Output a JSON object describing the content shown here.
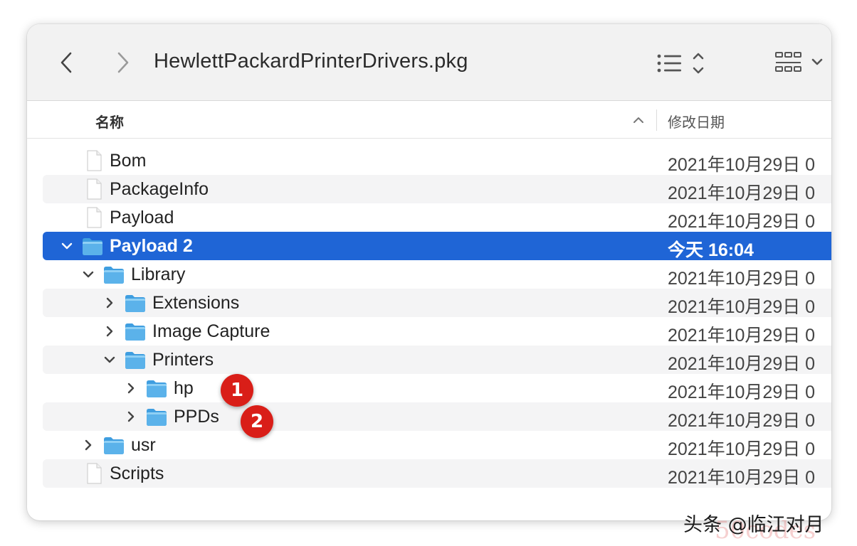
{
  "window": {
    "title": "HewlettPackardPrinterDrivers.pkg"
  },
  "columns": {
    "name": "名称",
    "date": "修改日期"
  },
  "rows": [
    {
      "name": "Bom",
      "date": "2021年10月29日 0",
      "kind": "file",
      "disclosure": "none",
      "selected": false
    },
    {
      "name": "PackageInfo",
      "date": "2021年10月29日 0",
      "kind": "file",
      "disclosure": "none",
      "selected": false
    },
    {
      "name": "Payload",
      "date": "2021年10月29日 0",
      "kind": "file",
      "disclosure": "none",
      "selected": false
    },
    {
      "name": "Payload 2",
      "date": "今天 16:04",
      "kind": "folder",
      "disclosure": "expanded",
      "selected": true
    },
    {
      "name": "Library",
      "date": "2021年10月29日 0",
      "kind": "folder",
      "disclosure": "expanded",
      "selected": false
    },
    {
      "name": "Extensions",
      "date": "2021年10月29日 0",
      "kind": "folder",
      "disclosure": "collapsed",
      "selected": false
    },
    {
      "name": "Image Capture",
      "date": "2021年10月29日 0",
      "kind": "folder",
      "disclosure": "collapsed",
      "selected": false
    },
    {
      "name": "Printers",
      "date": "2021年10月29日 0",
      "kind": "folder",
      "disclosure": "expanded",
      "selected": false
    },
    {
      "name": "hp",
      "date": "2021年10月29日 0",
      "kind": "folder",
      "disclosure": "collapsed",
      "selected": false
    },
    {
      "name": "PPDs",
      "date": "2021年10月29日 0",
      "kind": "folder",
      "disclosure": "collapsed",
      "selected": false
    },
    {
      "name": "usr",
      "date": "2021年10月29日 0",
      "kind": "folder",
      "disclosure": "collapsed",
      "selected": false
    },
    {
      "name": "Scripts",
      "date": "2021年10月29日 0",
      "kind": "file",
      "disclosure": "none",
      "selected": false
    }
  ],
  "annotations": [
    {
      "label": "1"
    },
    {
      "label": "2"
    }
  ],
  "watermark": {
    "text": "头条 @临江对月",
    "faint": "50codes"
  },
  "colors": {
    "selection": "#1f65d6",
    "folder": "#5bb2ea",
    "badge": "#d91e18"
  }
}
